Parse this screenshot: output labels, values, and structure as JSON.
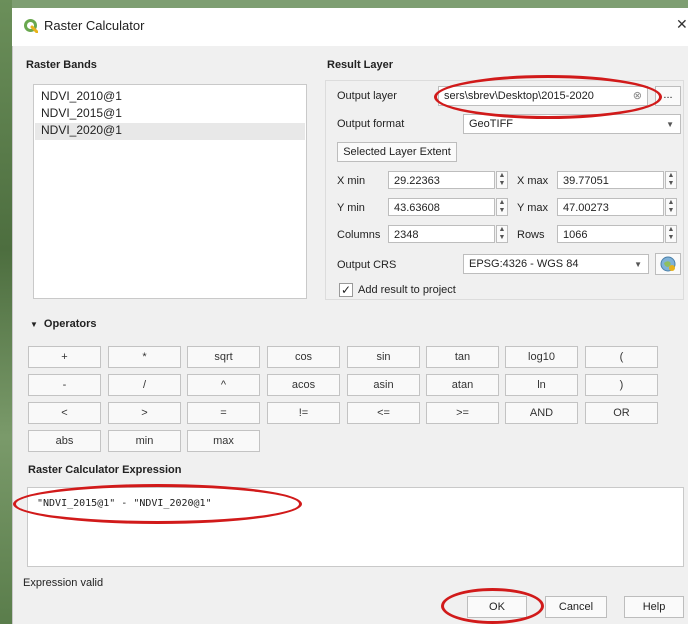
{
  "window": {
    "title": "Raster Calculator",
    "close_icon": "close-icon"
  },
  "raster_bands": {
    "heading": "Raster Bands",
    "items": [
      "NDVI_2010@1",
      "NDVI_2015@1",
      "NDVI_2020@1"
    ],
    "selected_index": 2
  },
  "result_layer": {
    "heading": "Result Layer",
    "output_layer_label": "Output layer",
    "output_layer_value": "sers\\sbrev\\Desktop\\2015-2020",
    "browse_label": "...",
    "output_format_label": "Output format",
    "output_format_value": "GeoTIFF",
    "selected_extent_label": "Selected Layer Extent",
    "xmin_label": "X min",
    "xmin_value": "29.22363",
    "xmax_label": "X max",
    "xmax_value": "39.77051",
    "ymin_label": "Y min",
    "ymin_value": "43.63608",
    "ymax_label": "Y max",
    "ymax_value": "47.00273",
    "columns_label": "Columns",
    "columns_value": "2348",
    "rows_label": "Rows",
    "rows_value": "1066",
    "crs_label": "Output CRS",
    "crs_value": "EPSG:4326 - WGS 84",
    "add_result_label": "Add result to project",
    "add_result_checked": true
  },
  "operators": {
    "heading": "Operators",
    "rows": [
      [
        "+",
        "*",
        "sqrt",
        "cos",
        "sin",
        "tan",
        "log10",
        "("
      ],
      [
        "-",
        "/",
        "^",
        "acos",
        "asin",
        "atan",
        "ln",
        ")"
      ],
      [
        "<",
        ">",
        "=",
        "!=",
        "<=",
        ">=",
        "AND",
        "OR"
      ],
      [
        "abs",
        "min",
        "max"
      ]
    ]
  },
  "expression": {
    "heading": "Raster Calculator Expression",
    "value": "\"NDVI_2015@1\" - \"NDVI_2020@1\"",
    "status": "Expression valid"
  },
  "footer": {
    "ok_label": "OK",
    "cancel_label": "Cancel",
    "help_label": "Help"
  },
  "colors": {
    "annotation_red": "#d11a1a",
    "qgis_green": "#6aa84f"
  }
}
